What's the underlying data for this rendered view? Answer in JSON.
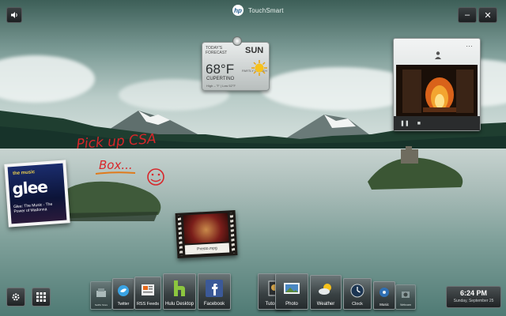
{
  "topbar": {
    "brand": "TouchSmart",
    "hp_logo_text": "hp",
    "minimize_label": "–",
    "close_label": "✕"
  },
  "weather_widget": {
    "forecast_label": "TODAY'S FORECAST",
    "day": "SUN",
    "temperature": "68°F",
    "city": "CUPERTINO",
    "high_low": "High – °F | Low 52°F",
    "condition": "PARTLY CLOUDY",
    "icon": "sun-icon"
  },
  "video_widget": {
    "menu": "…",
    "pause_label": "❚❚",
    "stop_label": "■"
  },
  "note": {
    "line1": "Pick up CSA",
    "line2": "Box...",
    "ink_color": "#d8262a",
    "underline_color": "#e07a1a"
  },
  "album": {
    "top_text": "the music",
    "title_art": "glee",
    "caption": "Glee: The Music - The Power of Madonna"
  },
  "movie": {
    "filename": "Presto.mpg"
  },
  "dock": {
    "tiles": [
      {
        "label": "Netflix Store",
        "icon": "store-icon"
      },
      {
        "label": "Twitter",
        "icon": "twitter-icon"
      },
      {
        "label": "RSS Feeds",
        "icon": "rss-icon"
      },
      {
        "label": "Hulu Desktop",
        "icon": "hulu-icon"
      },
      {
        "label": "Facebook",
        "icon": "facebook-icon"
      },
      {
        "label": "Tutorials",
        "icon": "tutorials-icon"
      },
      {
        "label": "Photo",
        "icon": "photo-icon"
      },
      {
        "label": "Weather",
        "icon": "weather-icon"
      },
      {
        "label": "Clock",
        "icon": "clock-icon"
      },
      {
        "label": "Music",
        "icon": "music-icon"
      },
      {
        "label": "Webcam",
        "icon": "webcam-icon"
      }
    ]
  },
  "clock": {
    "time": "6:24 PM",
    "date": "Sunday, September 25"
  },
  "colors": {
    "accent_blue": "#2f6fb3",
    "facebook_blue": "#3b5998",
    "hulu_green": "#8cc63f"
  }
}
